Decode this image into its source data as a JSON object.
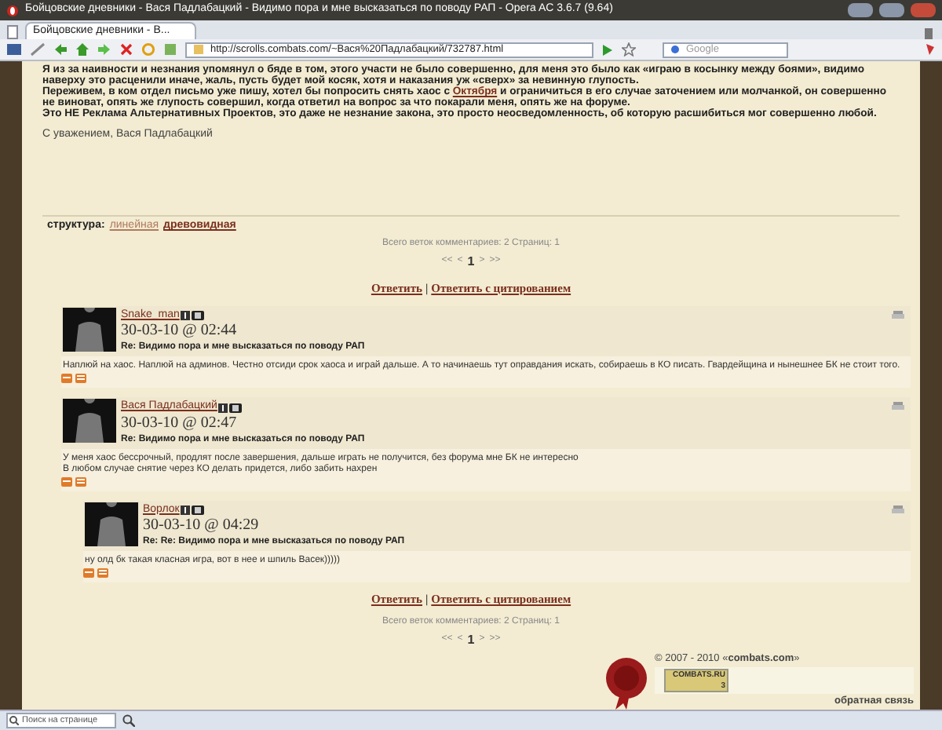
{
  "window": {
    "title": "Бойцовские дневники - Вася Падлабацкий - Видимо пора и мне высказаться по поводу РАП - Opera AC 3.6.7 (9.64)"
  },
  "tabs": [
    {
      "label": "Бойцовские дневники - В...",
      "selected": true
    }
  ],
  "address_bar": {
    "url": "http://scrolls.combats.com/~Вася%20Падлабацкий/732787.html"
  },
  "search_field": {
    "placeholder": "Google"
  },
  "article": {
    "paragraphs": [
      {
        "parts": [
          {
            "kind": "text",
            "text": "Я из за наивности и незнания упомянул о бяде в том, этого участи не было совершенно, для меня это было как «играю в косынку между боями», видимо наверху это расценили иначе, жаль, пусть будет мой косяк, хотя и наказания уж «сверх» за невинную глупость."
          }
        ]
      },
      {
        "parts": [
          {
            "kind": "text",
            "text": "Переживем, в ком отдел письмо уже пишу, хотел бы попросить снять хаос с "
          },
          {
            "kind": "link",
            "text": "Октября"
          },
          {
            "kind": "text",
            "text": " и ограничиться в его случае заточением или молчанкой, он совершенно не виноват, опять же глупость совершил, когда ответил на вопрос за что покарали меня, опять же на форуме."
          }
        ]
      },
      {
        "parts": [
          {
            "kind": "text",
            "text": "Это НЕ Реклама Альтернативных Проектов, это даже не незнание закона, это просто неосведомленность, об которую расшибиться мог совершенно любой."
          }
        ]
      }
    ],
    "signature": "С уважением, Вася Падлабацкий"
  },
  "structure": {
    "label": "структура:",
    "options": [
      {
        "label": "линейная",
        "selected": false
      },
      {
        "label": "древовидная",
        "selected": true
      }
    ]
  },
  "summary_top": {
    "text": "Всего веток комментариев:",
    "count": "2",
    "pages_label": "Страниц:",
    "pages": "1"
  },
  "pager_top": {
    "first": "<<",
    "prev": "<",
    "current": "1",
    "next": ">",
    "last": ">>"
  },
  "reply_links_top": [
    "Ответить",
    "|",
    "Ответить с цитированием"
  ],
  "comments": [
    {
      "author": "Snake_man",
      "date": "30-03-10 @ 02:44",
      "subject": "Re: Видимо пора и мне высказаться по поводу РАП",
      "body": [
        "Наплюй на хаос. Наплюй на админов. Честно отсиди срок хаоса и играй дальше. А то начинаешь тут оправдания искать, собираешь в КО писать. Гвардейщина и нынешнее БК не стоит того."
      ]
    },
    {
      "author": "Вася Падлабацкий",
      "date": "30-03-10 @ 02:47",
      "subject": "Re: Видимо пора и мне высказаться по поводу РАП",
      "body": [
        "У меня хаос бессрочный, продлят после завершения, дальше играть не получится, без форума мне БК не интересно",
        "В любом случае снятие через КО делать придется, либо забить нахрен"
      ],
      "children": [
        {
          "author": "Ворлок",
          "date": "30-03-10 @ 04:29",
          "subject": "Re: Re: Видимо пора и мне высказаться по поводу РАП",
          "body": [
            "ну олд бк такая класная игра, вот в нее и шпиль Васек)))))"
          ]
        }
      ]
    }
  ],
  "reply_links_bottom": [
    "Ответить",
    "|",
    "Ответить с цитированием"
  ],
  "summary_bottom": {
    "text": "Всего веток комментариев:",
    "count": "2",
    "pages_label": "Страниц:",
    "pages": "1"
  },
  "pager_bottom": {
    "first": "<<",
    "prev": "<",
    "current": "1",
    "next": ">",
    "last": ">>"
  },
  "footer": {
    "copyright": "© 2007 - 2010 «",
    "site": "combats.com",
    "copyright_end": "»",
    "counter_label": "COMBATS.RU",
    "counter_value": "3",
    "feedback": "обратная связь"
  },
  "find_bar": {
    "placeholder": "Поиск на странице"
  }
}
